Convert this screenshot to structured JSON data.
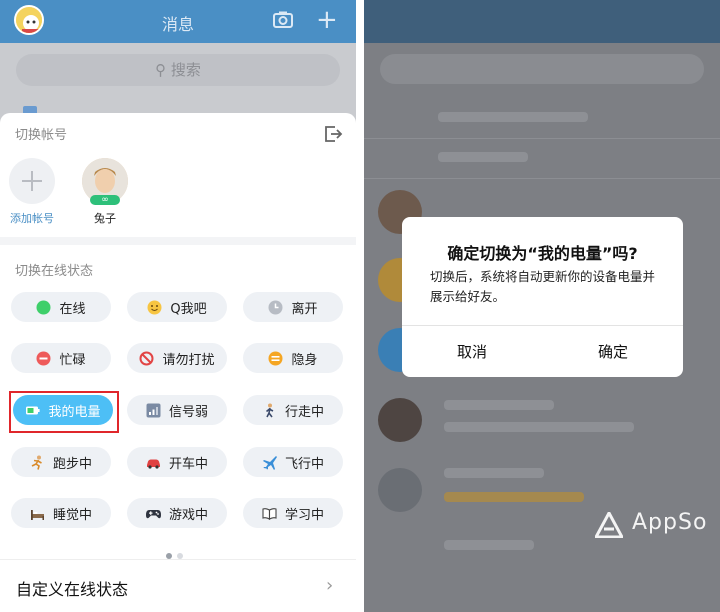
{
  "left": {
    "header": {
      "title": "消息"
    },
    "search": {
      "placeholder": "搜索"
    },
    "switch_account": {
      "label": "切换帐号",
      "accounts": [
        {
          "name": "添加帐号",
          "type": "add"
        },
        {
          "name": "兔子",
          "type": "user",
          "badge": "∞"
        }
      ]
    },
    "online_status": {
      "label": "切换在线状态",
      "statuses": [
        {
          "label": "在线",
          "icon": "green-dot-icon"
        },
        {
          "label": "Q我吧",
          "icon": "smiley-icon"
        },
        {
          "label": "离开",
          "icon": "clock-icon"
        },
        {
          "label": "忙碌",
          "icon": "minus-circle-icon"
        },
        {
          "label": "请勿打扰",
          "icon": "no-entry-icon"
        },
        {
          "label": "隐身",
          "icon": "hidden-icon"
        },
        {
          "label": "我的电量",
          "icon": "battery-icon",
          "active": true
        },
        {
          "label": "信号弱",
          "icon": "signal-icon"
        },
        {
          "label": "行走中",
          "icon": "walking-icon"
        },
        {
          "label": "跑步中",
          "icon": "running-icon"
        },
        {
          "label": "开车中",
          "icon": "car-icon"
        },
        {
          "label": "飞行中",
          "icon": "airplane-icon"
        },
        {
          "label": "睡觉中",
          "icon": "bed-icon"
        },
        {
          "label": "游戏中",
          "icon": "gamepad-icon"
        },
        {
          "label": "学习中",
          "icon": "book-icon"
        }
      ],
      "page_dots": {
        "count": 2,
        "current": 1
      }
    },
    "custom_status": {
      "label": "自定义在线状态"
    }
  },
  "right": {
    "dialog": {
      "title": "确定切换为“我的电量”吗?",
      "body": "切换后，系统将自动更新你的设备电量并展示给好友。",
      "cancel": "取消",
      "confirm": "确定"
    }
  },
  "watermark": "AppSo",
  "colors": {
    "header_blue": "#4a8fc5",
    "active_chip": "#4dbff6",
    "highlight_red": "#e0262b",
    "online_green": "#2ec07a"
  }
}
